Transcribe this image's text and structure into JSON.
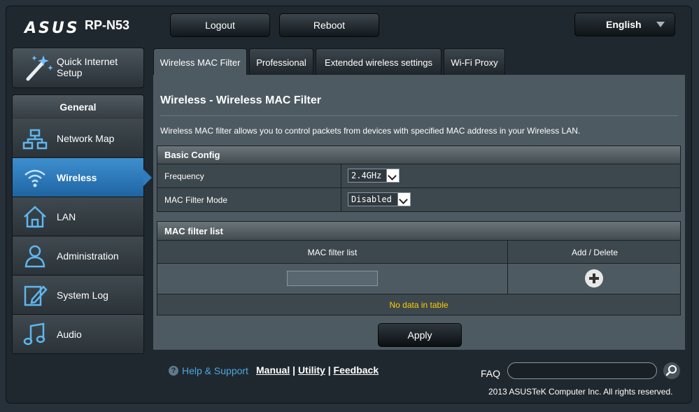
{
  "header": {
    "logo": "ASUS",
    "model": "RP-N53",
    "logout_label": "Logout",
    "reboot_label": "Reboot",
    "language": "English"
  },
  "sidebar": {
    "quick_setup_line1": "Quick Internet",
    "quick_setup_line2": "Setup",
    "section_title": "General",
    "items": [
      {
        "label": "Network Map",
        "icon": "network-map-icon"
      },
      {
        "label": "Wireless",
        "icon": "wifi-icon",
        "active": true
      },
      {
        "label": "LAN",
        "icon": "house-icon"
      },
      {
        "label": "Administration",
        "icon": "user-icon"
      },
      {
        "label": "System Log",
        "icon": "log-edit-icon"
      },
      {
        "label": "Audio",
        "icon": "music-note-icon"
      }
    ]
  },
  "tabs": [
    {
      "label": "Wireless MAC Filter",
      "active": true
    },
    {
      "label": "Professional"
    },
    {
      "label": "Extended wireless settings"
    },
    {
      "label": "Wi-Fi Proxy"
    }
  ],
  "main": {
    "title": "Wireless - Wireless MAC Filter",
    "description": "Wireless MAC filter allows you to control packets from devices with specified MAC address in your Wireless LAN.",
    "basic_config": {
      "header": "Basic Config",
      "frequency_label": "Frequency",
      "frequency_value": "2.4GHz",
      "mode_label": "MAC Filter Mode",
      "mode_value": "Disabled"
    },
    "mac_list": {
      "header": "MAC filter list",
      "col_list": "MAC filter list",
      "col_action": "Add / Delete",
      "empty": "No data in table"
    },
    "apply_label": "Apply"
  },
  "footer": {
    "help": "Help & Support",
    "manual": "Manual",
    "utility": "Utility",
    "feedback": "Feedback",
    "faq": "FAQ",
    "copyright": "2013 ASUSTeK Computer Inc. All rights reserved."
  },
  "colors": {
    "accent": "#2f7cbf",
    "warning_text": "#ffcc00",
    "help_link": "#4aa8e0"
  }
}
